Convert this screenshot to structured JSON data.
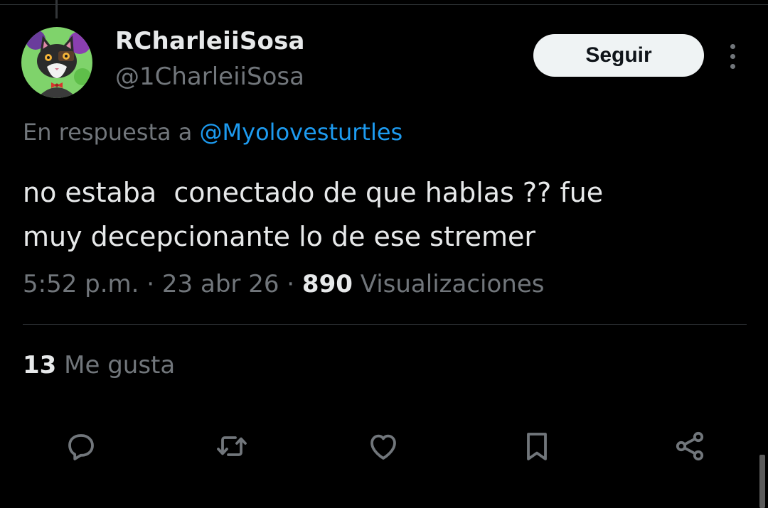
{
  "author": {
    "display_name": "RCharleiiSosa",
    "handle": "@1CharleiiSosa",
    "avatar_icon": "cat-avatar"
  },
  "follow_label": "Seguir",
  "more_icon": "more-vertical-icon",
  "reply_to": {
    "prefix": "En respuesta a ",
    "mention": "@Myolovesturtles"
  },
  "tweet_text": "no estaba  conectado de que hablas ?? fue\nmuy decepcionante lo de ese stremer",
  "meta": {
    "time": "5:52 p.m.",
    "sep1": " · ",
    "date": "23 abr 26",
    "sep2": " · ",
    "views_count": "890",
    "views_label": " Visualizaciones"
  },
  "likes": {
    "count": "13",
    "label": " Me gusta"
  },
  "actions": [
    {
      "name": "reply",
      "icon": "reply-icon"
    },
    {
      "name": "repost",
      "icon": "repost-icon"
    },
    {
      "name": "like",
      "icon": "heart-icon"
    },
    {
      "name": "bookmark",
      "icon": "bookmark-icon"
    },
    {
      "name": "share",
      "icon": "share-icon"
    }
  ],
  "colors": {
    "background": "#000000",
    "text": "#e7e9ea",
    "secondary": "#71767b",
    "link": "#1d9bf0",
    "button_bg": "#eff3f4"
  }
}
